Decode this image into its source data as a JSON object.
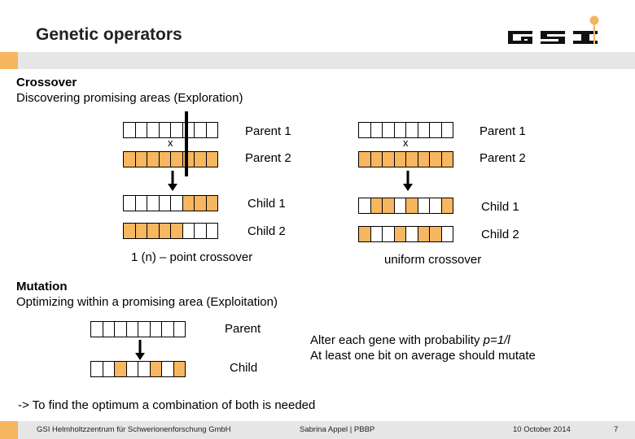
{
  "slide": {
    "title": "Genetic operators",
    "logo": "GSI-logo",
    "colors": {
      "accent": "#f7b660",
      "band": "#e6e6e6",
      "text": "#000000"
    }
  },
  "crossover": {
    "heading": "Crossover",
    "subheading": "Discovering promising areas (Exploration)",
    "one_point": {
      "caption": "1 (n) – point crossover",
      "x_mark": "x",
      "rows": [
        {
          "label": "Parent 1",
          "genes": [
            "w",
            "w",
            "w",
            "w",
            "w",
            "w",
            "w",
            "w"
          ]
        },
        {
          "label": "Parent 2",
          "genes": [
            "o",
            "o",
            "o",
            "o",
            "o",
            "o",
            "o",
            "o"
          ]
        },
        {
          "label": "Child 1",
          "genes": [
            "w",
            "w",
            "w",
            "w",
            "w",
            "o",
            "o",
            "o"
          ]
        },
        {
          "label": "Child 2",
          "genes": [
            "o",
            "o",
            "o",
            "o",
            "o",
            "w",
            "w",
            "w"
          ]
        }
      ]
    },
    "uniform": {
      "caption": "uniform crossover",
      "x_mark": "x",
      "rows": [
        {
          "label": "Parent 1",
          "genes": [
            "w",
            "w",
            "w",
            "w",
            "w",
            "w",
            "w",
            "w"
          ]
        },
        {
          "label": "Parent 2",
          "genes": [
            "o",
            "o",
            "o",
            "o",
            "o",
            "o",
            "o",
            "o"
          ]
        },
        {
          "label": "Child 1",
          "genes": [
            "w",
            "o",
            "o",
            "w",
            "o",
            "w",
            "w",
            "o"
          ]
        },
        {
          "label": "Child 2",
          "genes": [
            "o",
            "w",
            "w",
            "o",
            "w",
            "o",
            "o",
            "w"
          ]
        }
      ]
    }
  },
  "mutation": {
    "heading": "Mutation",
    "subheading": "Optimizing within a promising area (Exploitation)",
    "rows": [
      {
        "label": "Parent",
        "genes": [
          "w",
          "w",
          "w",
          "w",
          "w",
          "w",
          "w",
          "w"
        ]
      },
      {
        "label": "Child",
        "genes": [
          "w",
          "w",
          "o",
          "w",
          "w",
          "o",
          "w",
          "o"
        ]
      }
    ],
    "note_line1_prefix": "Alter each gene with probability ",
    "note_line1_formula": "p=1/l",
    "note_line2": "At least one bit on average should mutate"
  },
  "conclusion": "-> To find the optimum a combination of both is needed",
  "footer": {
    "organization": "GSI Helmholtzzentrum für Schwerionenforschung GmbH",
    "author": "Sabrina Appel | PBBP",
    "date": "10 October 2014",
    "page": "7"
  }
}
